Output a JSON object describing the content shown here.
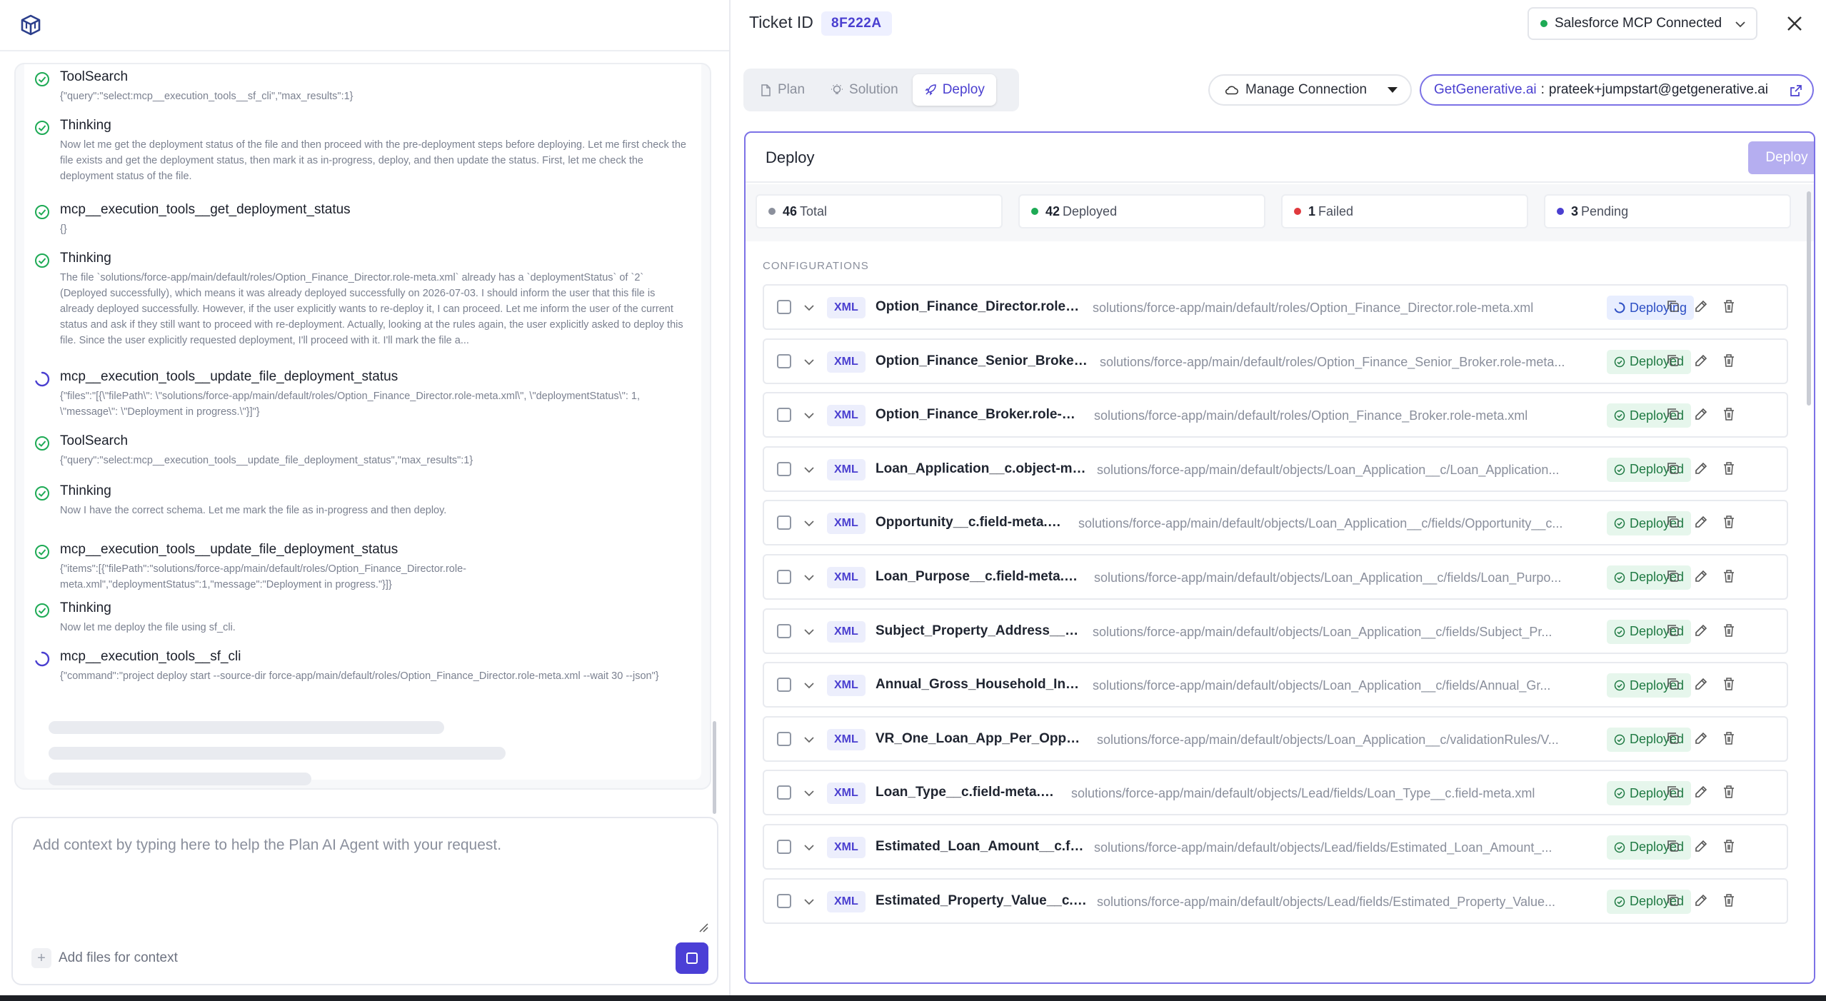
{
  "colors": {
    "accent": "#4a3fd0",
    "success": "#1eaa55",
    "failed": "#e0393e",
    "pending": "#4a3fd0",
    "total": "#8b909c"
  },
  "chat": {
    "steps": [
      {
        "icon": "check-circle-icon",
        "title": "ToolSearch",
        "body": "{\"query\":\"select:mcp__execution_tools__sf_cli\",\"max_results\":1}"
      },
      {
        "icon": "check-circle-icon",
        "title": "Thinking",
        "body": "Now let me get the deployment status of the file and then proceed with the pre-deployment steps before deploying. Let me first check the file exists and get the deployment status, then mark it as in-progress, deploy, and then update the status. First, let me check the deployment status of the file."
      },
      {
        "icon": "check-circle-icon",
        "title": "mcp__execution_tools__get_deployment_status",
        "body": "{}"
      },
      {
        "icon": "check-circle-icon",
        "title": "Thinking",
        "body": "The file `solutions/force-app/main/default/roles/Option_Finance_Director.role-meta.xml` already has a `deploymentStatus` of `2` (Deployed successfully), which means it was already deployed successfully on 2026-07-03. I should inform the user that this file is already deployed successfully. However, if the user explicitly wants to re-deploy it, I can proceed. Let me inform the user of the current status and ask if they still want to proceed with re-deployment. Actually, looking at the rules again, the user explicitly asked to deploy this file. Since the user explicitly requested deployment, I'll proceed with it. I'll mark the file a..."
      },
      {
        "icon": "spinner-icon",
        "title": "mcp__execution_tools__update_file_deployment_status",
        "body": "{\"files\":\"[{\\\"filePath\\\": \\\"solutions/force-app/main/default/roles/Option_Finance_Director.role-meta.xml\\\", \\\"deploymentStatus\\\": 1, \\\"message\\\": \\\"Deployment in progress.\\\"}]\"}"
      },
      {
        "icon": "check-circle-icon",
        "title": "ToolSearch",
        "body": "{\"query\":\"select:mcp__execution_tools__update_file_deployment_status\",\"max_results\":1}"
      },
      {
        "icon": "check-circle-icon",
        "title": "Thinking",
        "body": "Now I have the correct schema. Let me mark the file as in-progress and then deploy."
      },
      {
        "icon": "check-circle-icon",
        "title": "mcp__execution_tools__update_file_deployment_status",
        "body": "{\"items\":[{\"filePath\":\"solutions/force-app/main/default/roles/Option_Finance_Director.role-meta.xml\",\"deploymentStatus\":1,\"message\":\"Deployment in progress.\"}]}"
      },
      {
        "icon": "check-circle-icon",
        "title": "Thinking",
        "body": "Now let me deploy the file using sf_cli."
      },
      {
        "icon": "spinner-icon",
        "title": "mcp__execution_tools__sf_cli",
        "body": "{\"command\":\"project deploy start --source-dir force-app/main/default/roles/Option_Finance_Director.role-meta.xml --wait 30 --json\"}"
      }
    ]
  },
  "composer": {
    "placeholder": "Add context by typing here to help the Plan AI Agent with your request.",
    "add_files": "Add files for context"
  },
  "header": {
    "ticket_label": "Ticket ID",
    "ticket_id": "8F222A",
    "connection": "Salesforce MCP Connected"
  },
  "tabs": [
    {
      "label": "Plan",
      "icon": "document-icon",
      "active": false
    },
    {
      "label": "Solution",
      "icon": "lightbulb-icon",
      "active": false
    },
    {
      "label": "Deploy",
      "icon": "rocket-icon",
      "active": true
    }
  ],
  "manage_connection": "Manage Connection",
  "account": {
    "brand": "GetGenerative.ai",
    "separator": ":",
    "email": "prateek+jumpstart@getgenerative.ai"
  },
  "deploy": {
    "title": "Deploy",
    "button": "Deploy",
    "stats": [
      {
        "count": "46",
        "label": "Total",
        "color": "#8b909c"
      },
      {
        "count": "42",
        "label": "Deployed",
        "color": "#1eaa55"
      },
      {
        "count": "1",
        "label": "Failed",
        "color": "#e0393e"
      },
      {
        "count": "3",
        "label": "Pending",
        "color": "#4a3fd0"
      }
    ],
    "section_label": "CONFIGURATIONS",
    "files": [
      {
        "type": "XML",
        "name": "Option_Finance_Director.role-m...",
        "path": "solutions/force-app/main/default/roles/Option_Finance_Director.role-meta.xml",
        "status": "Deploying"
      },
      {
        "type": "XML",
        "name": "Option_Finance_Senior_Broker.r...",
        "path": "solutions/force-app/main/default/roles/Option_Finance_Senior_Broker.role-meta...",
        "status": "Deployed"
      },
      {
        "type": "XML",
        "name": "Option_Finance_Broker.role-met...",
        "path": "solutions/force-app/main/default/roles/Option_Finance_Broker.role-meta.xml",
        "status": "Deployed"
      },
      {
        "type": "XML",
        "name": "Loan_Application__c.object-met...",
        "path": "solutions/force-app/main/default/objects/Loan_Application__c/Loan_Application...",
        "status": "Deployed"
      },
      {
        "type": "XML",
        "name": "Opportunity__c.field-meta.xml",
        "path": "solutions/force-app/main/default/objects/Loan_Application__c/fields/Opportunity__c...",
        "status": "Deployed"
      },
      {
        "type": "XML",
        "name": "Loan_Purpose__c.field-meta.xml",
        "path": "solutions/force-app/main/default/objects/Loan_Application__c/fields/Loan_Purpo...",
        "status": "Deployed"
      },
      {
        "type": "XML",
        "name": "Subject_Property_Address__c.fi...",
        "path": "solutions/force-app/main/default/objects/Loan_Application__c/fields/Subject_Pr...",
        "status": "Deployed"
      },
      {
        "type": "XML",
        "name": "Annual_Gross_Household_Inco...",
        "path": "solutions/force-app/main/default/objects/Loan_Application__c/fields/Annual_Gr...",
        "status": "Deployed"
      },
      {
        "type": "XML",
        "name": "VR_One_Loan_App_Per_Opportu...",
        "path": "solutions/force-app/main/default/objects/Loan_Application__c/validationRules/V...",
        "status": "Deployed"
      },
      {
        "type": "XML",
        "name": "Loan_Type__c.field-meta.xml",
        "path": "solutions/force-app/main/default/objects/Lead/fields/Loan_Type__c.field-meta.xml",
        "status": "Deployed"
      },
      {
        "type": "XML",
        "name": "Estimated_Loan_Amount__c.fiel...",
        "path": "solutions/force-app/main/default/objects/Lead/fields/Estimated_Loan_Amount_...",
        "status": "Deployed"
      },
      {
        "type": "XML",
        "name": "Estimated_Property_Value__c.fie...",
        "path": "solutions/force-app/main/default/objects/Lead/fields/Estimated_Property_Value...",
        "status": "Deployed"
      }
    ]
  }
}
